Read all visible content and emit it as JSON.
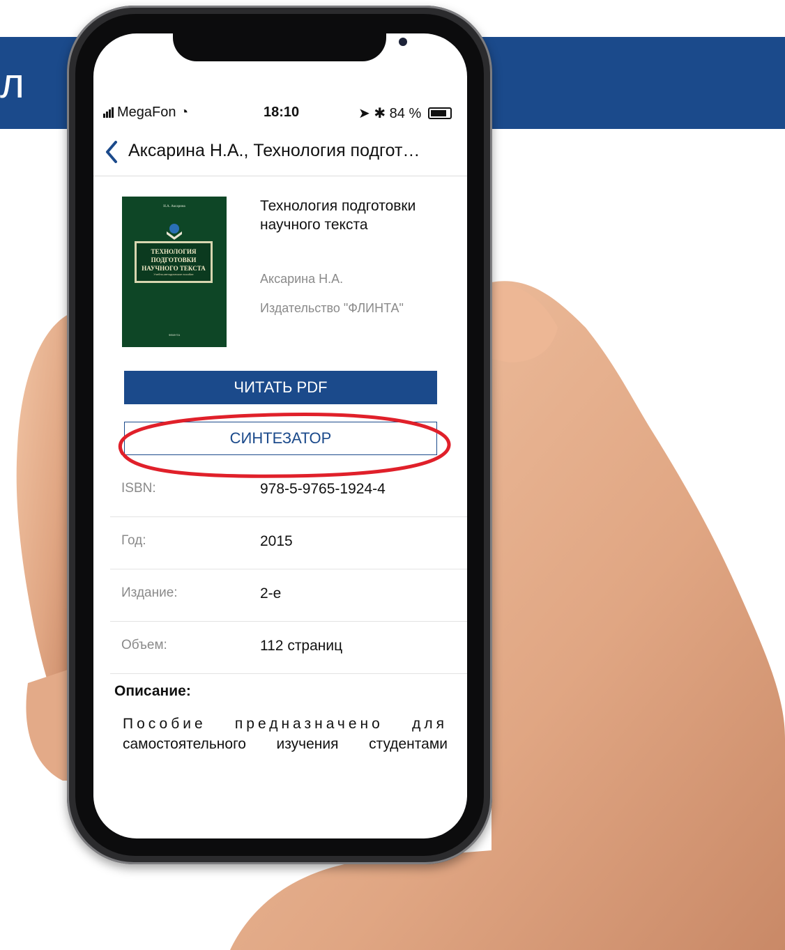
{
  "banner": {
    "text": "л",
    "color": "#1b4a8b"
  },
  "status_bar": {
    "carrier": "MegaFon",
    "time": "18:10",
    "battery": "84 %"
  },
  "nav": {
    "title": "Аксарина Н.А., Технология подгот…"
  },
  "book": {
    "title": "Технология подготовки научного текста",
    "author": "Аксарина Н.А.",
    "publisher": "Издательство \"ФЛИНТА\"",
    "cover": {
      "author": "Н.А. Аксарина",
      "title": "ТЕХНОЛОГИЯ ПОДГОТОВКИ НАУЧНОГО ТЕКСТА",
      "subtitle": "Учебно-методическое пособие",
      "publisher": "ФЛИНТА"
    }
  },
  "buttons": {
    "read_pdf": "ЧИТАТЬ PDF",
    "synthesizer": "СИНТЕЗАТОР"
  },
  "details": [
    {
      "label": "ISBN:",
      "value": "978-5-9765-1924-4"
    },
    {
      "label": "Год:",
      "value": "2015"
    },
    {
      "label": "Издание:",
      "value": "2-е"
    },
    {
      "label": "Объем:",
      "value": "112 страниц"
    }
  ],
  "description": {
    "heading": "Описание:",
    "line1": "Пособие предназначено для",
    "line2": "самостоятельного изучения студентами"
  },
  "colors": {
    "accent": "#1b4a8b",
    "highlight": "#e0202a",
    "cover": "#0e4626"
  }
}
